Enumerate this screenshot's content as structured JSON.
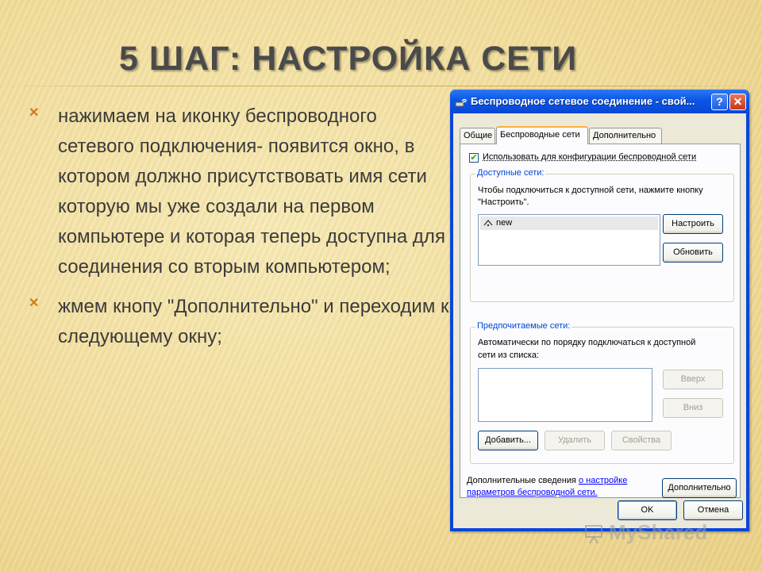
{
  "slide": {
    "title": "5 ШАГ: НАСТРОЙКА СЕТИ",
    "bullets": [
      "нажимаем на иконку беспроводного сетевого подключения- появится окно, в котором должно присутствовать имя сети которую мы уже создали на первом компьютере и которая теперь доступна для соединения со вторым компьютером;",
      "жмем кнопу \"Дополнительно\" и переходим к следующему окну;"
    ]
  },
  "dialog": {
    "title": "Беспроводное сетевое соединение - свой...",
    "help_label": "?",
    "close_label": "✕",
    "tabs": [
      {
        "label": "Общие",
        "active": false
      },
      {
        "label": "Беспроводные сети",
        "active": true
      },
      {
        "label": "Дополнительно",
        "active": false
      }
    ],
    "use_windows_config": {
      "label": "Использовать для конфигурации беспроводной сети",
      "checked": true
    },
    "available": {
      "group_label": "Доступные сети:",
      "description_line1": "Чтобы подключиться к доступной сети, нажмите кнопку",
      "description_line2": "\"Настроить\".",
      "networks": [
        "new"
      ],
      "configure_button": "Настроить",
      "refresh_button": "Обновить"
    },
    "preferred": {
      "group_label": "Предпочитаемые сети:",
      "description_line1": "Автоматически по порядку подключаться к доступной",
      "description_line2": "сети из списка:",
      "up_button": "Вверх",
      "down_button": "Вниз",
      "add_button": "Добавить...",
      "remove_button": "Удалить",
      "properties_button": "Свойства"
    },
    "info": {
      "line1_text": "Дополнительные сведения ",
      "line1_link": "о настройке",
      "line2_link": "параметров беспроводной сети.",
      "advanced_button": "Дополнительно"
    },
    "ok_button": "OK",
    "cancel_button": "Отмена"
  },
  "watermark": "MyShared",
  "colors": {
    "title_bar": "#0a55e4",
    "dialog_bg": "#ece9d8",
    "bullet_accent": "#d27a1b",
    "link": "#0000ff"
  }
}
